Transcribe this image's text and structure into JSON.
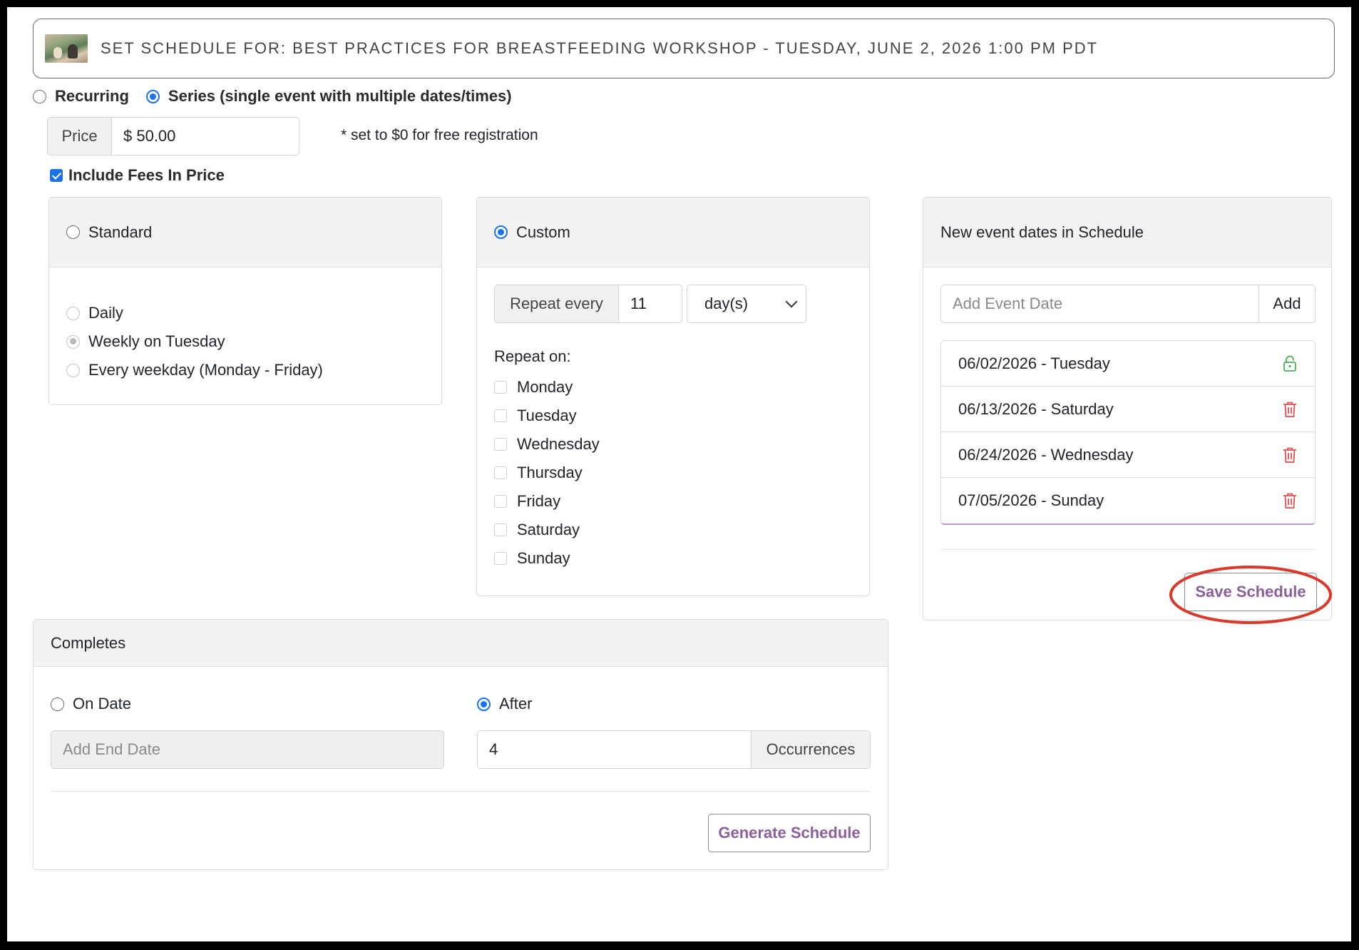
{
  "header": {
    "title": "SET SCHEDULE FOR: BEST PRACTICES FOR BREASTFEEDING WORKSHOP - TUESDAY, JUNE 2, 2026 1:00 PM PDT"
  },
  "schedule_type": {
    "recurring_label": "Recurring",
    "series_label": "Series (single event with multiple dates/times)",
    "selected": "series"
  },
  "price": {
    "label": "Price",
    "value": "$ 50.00",
    "note": "* set to $0 for free registration",
    "include_fees_label": "Include Fees In Price",
    "include_fees_checked": true
  },
  "standard": {
    "label": "Standard",
    "options": [
      "Daily",
      "Weekly on Tuesday",
      "Every weekday (Monday - Friday)"
    ],
    "selected_option": "Weekly on Tuesday"
  },
  "custom": {
    "label": "Custom",
    "repeat_every_label": "Repeat every",
    "repeat_every_value": "11",
    "unit_value": "day(s)",
    "repeat_on_label": "Repeat on:",
    "days": [
      "Monday",
      "Tuesday",
      "Wednesday",
      "Thursday",
      "Friday",
      "Saturday",
      "Sunday"
    ]
  },
  "completes": {
    "title": "Completes",
    "on_date_label": "On Date",
    "end_date_placeholder": "Add End Date",
    "after_label": "After",
    "occurrences_value": "4",
    "occurrences_label": "Occurrences",
    "selected": "after",
    "generate_label": "Generate Schedule"
  },
  "event_dates": {
    "title": "New event dates in Schedule",
    "add_placeholder": "Add Event Date",
    "add_label": "Add",
    "items": [
      {
        "label": "06/02/2026 - Tuesday",
        "icon": "lock-icon"
      },
      {
        "label": "06/13/2026 - Saturday",
        "icon": "trash-icon"
      },
      {
        "label": "06/24/2026 - Wednesday",
        "icon": "trash-icon"
      },
      {
        "label": "07/05/2026 - Sunday",
        "icon": "trash-icon"
      }
    ],
    "save_label": "Save Schedule"
  },
  "colors": {
    "accent_blue": "#1a73e8",
    "button_text_purple": "#8b5f9e",
    "highlight_red": "#d9382b",
    "lock_green": "#4caf50",
    "trash_red": "#e05050"
  }
}
